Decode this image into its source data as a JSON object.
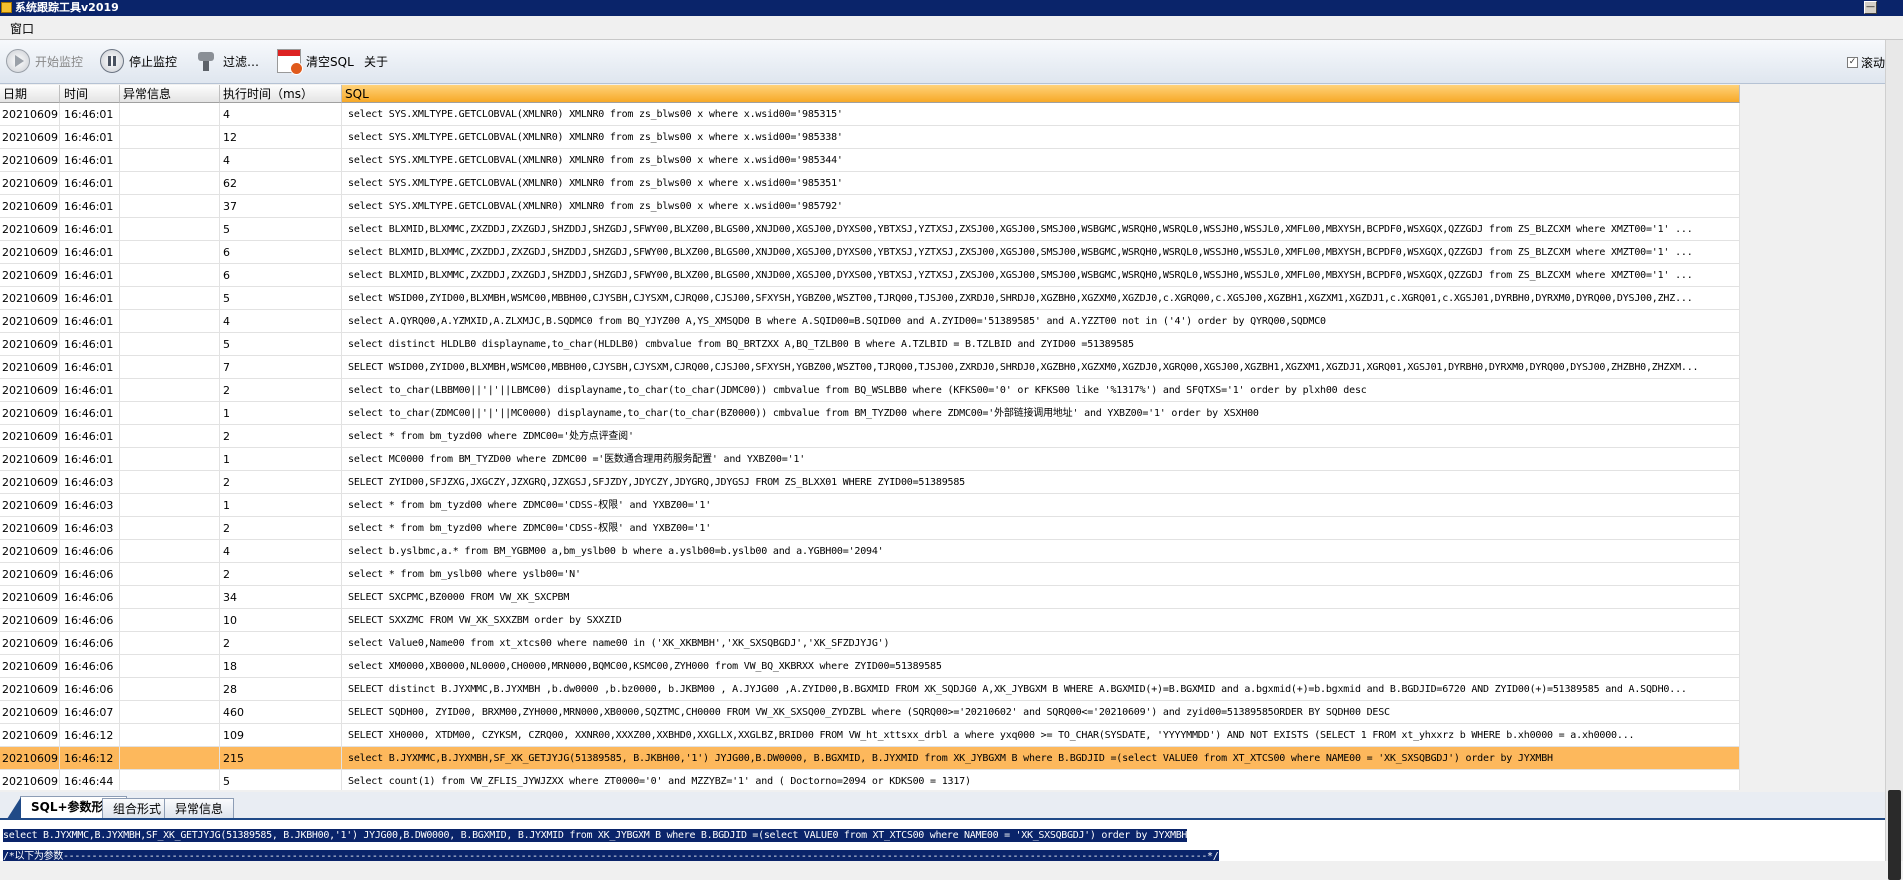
{
  "window": {
    "title": "系统跟踪工具v2019",
    "minimize_glyph": "—"
  },
  "menu": {
    "items": [
      "窗口"
    ]
  },
  "toolbar": {
    "start_label": "开始监控",
    "stop_label": "停止监控",
    "filter_label": "过滤…",
    "clear_label": "清空SQL",
    "about_label": "关于",
    "scroll_label": "滚动",
    "scroll_checked": "✓"
  },
  "grid": {
    "columns": [
      "日期",
      "时间",
      "异常信息",
      "执行时间（ms）",
      "SQL"
    ],
    "rows": [
      {
        "date": "20210609",
        "time": "16:46:01",
        "err": "",
        "ms": "4",
        "sql": "select    SYS.XMLTYPE.GETCLOBVAL(XMLNR0)  XMLNR0 from zs_blws00 x where x.wsid00='985315'"
      },
      {
        "date": "20210609",
        "time": "16:46:01",
        "err": "",
        "ms": "12",
        "sql": "select    SYS.XMLTYPE.GETCLOBVAL(XMLNR0)  XMLNR0 from zs_blws00 x where x.wsid00='985338'"
      },
      {
        "date": "20210609",
        "time": "16:46:01",
        "err": "",
        "ms": "4",
        "sql": "select    SYS.XMLTYPE.GETCLOBVAL(XMLNR0)  XMLNR0 from zs_blws00 x where x.wsid00='985344'"
      },
      {
        "date": "20210609",
        "time": "16:46:01",
        "err": "",
        "ms": "62",
        "sql": "select    SYS.XMLTYPE.GETCLOBVAL(XMLNR0)  XMLNR0 from zs_blws00 x where x.wsid00='985351'"
      },
      {
        "date": "20210609",
        "time": "16:46:01",
        "err": "",
        "ms": "37",
        "sql": "select    SYS.XMLTYPE.GETCLOBVAL(XMLNR0)  XMLNR0 from zs_blws00 x where x.wsid00='985792'"
      },
      {
        "date": "20210609",
        "time": "16:46:01",
        "err": "",
        "ms": "5",
        "sql": "select BLXMID,BLXMMC,ZXZDDJ,ZXZGDJ,SHZDDJ,SHZGDJ,SFWY00,BLXZ00,BLGS00,XNJD00,XGSJ00,DYXS00,YBTXSJ,YZTXSJ,ZXSJ00,XGSJ00,SMSJ00,WSBGMC,WSRQH0,WSRQL0,WSSJH0,WSSJL0,XMFL00,MBXYSH,BCPDF0,WSXGQX,QZZGDJ  from ZS_BLZCXM where XMZT00='1' ..."
      },
      {
        "date": "20210609",
        "time": "16:46:01",
        "err": "",
        "ms": "6",
        "sql": "select BLXMID,BLXMMC,ZXZDDJ,ZXZGDJ,SHZDDJ,SHZGDJ,SFWY00,BLXZ00,BLGS00,XNJD00,XGSJ00,DYXS00,YBTXSJ,YZTXSJ,ZXSJ00,XGSJ00,SMSJ00,WSBGMC,WSRQH0,WSRQL0,WSSJH0,WSSJL0,XMFL00,MBXYSH,BCPDF0,WSXGQX,QZZGDJ  from ZS_BLZCXM where XMZT00='1' ..."
      },
      {
        "date": "20210609",
        "time": "16:46:01",
        "err": "",
        "ms": "6",
        "sql": "select BLXMID,BLXMMC,ZXZDDJ,ZXZGDJ,SHZDDJ,SHZGDJ,SFWY00,BLXZ00,BLGS00,XNJD00,XGSJ00,DYXS00,YBTXSJ,YZTXSJ,ZXSJ00,XGSJ00,SMSJ00,WSBGMC,WSRQH0,WSRQL0,WSSJH0,WSSJL0,XMFL00,MBXYSH,BCPDF0,WSXGQX,QZZGDJ  from ZS_BLZCXM where XMZT00='1' ..."
      },
      {
        "date": "20210609",
        "time": "16:46:01",
        "err": "",
        "ms": "5",
        "sql": "select  WSID00,ZYID00,BLXMBH,WSMC00,MBBH00,CJYSBH,CJYSXM,CJRQ00,CJSJ00,SFXYSH,YGBZ00,WSZT00,TJRQ00,TJSJ00,ZXRDJ0,SHRDJ0,XGZBH0,XGZXM0,XGZDJ0,c.XGRQ00,c.XGSJ00,XGZBH1,XGZXM1,XGZDJ1,c.XGRQ01,c.XGSJ01,DYRBH0,DYRXM0,DYRQ00,DYSJ00,ZHZ..."
      },
      {
        "date": "20210609",
        "time": "16:46:01",
        "err": "",
        "ms": "4",
        "sql": "select A.QYRQ00,A.YZMXID,A.ZLXMJC,B.SQDMC0 from BQ_YJYZ00 A,YS_XMSQD0 B where A.SQID00=B.SQID00 and A.ZYID00='51389585' and A.YZZT00 not in ('4') order by QYRQ00,SQDMC0"
      },
      {
        "date": "20210609",
        "time": "16:46:01",
        "err": "",
        "ms": "5",
        "sql": "select distinct HLDLB0 displayname,to_char(HLDLB0) cmbvalue from BQ_BRTZXX A,BQ_TZLB00 B  where A.TZLBID = B.TZLBID and ZYID00 =51389585"
      },
      {
        "date": "20210609",
        "time": "16:46:01",
        "err": "",
        "ms": "7",
        "sql": "SELECT WSID00,ZYID00,BLXMBH,WSMC00,MBBH00,CJYSBH,CJYSXM,CJRQ00,CJSJ00,SFXYSH,YGBZ00,WSZT00,TJRQ00,TJSJ00,ZXRDJ0,SHRDJ0,XGZBH0,XGZXM0,XGZDJ0,XGRQ00,XGSJ00,XGZBH1,XGZXM1,XGZDJ1,XGRQ01,XGSJ01,DYRBH0,DYRXM0,DYRQ00,DYSJ00,ZHZBH0,ZHZXM..."
      },
      {
        "date": "20210609",
        "time": "16:46:01",
        "err": "",
        "ms": "2",
        "sql": "select to_char(LBBM00||'|'||LBMC00) displayname,to_char(to_char(JDMC00)) cmbvalue from BQ_WSLBB0  where (KFKS00='0' or KFKS00 like '%1317%') and SFQTXS='1' order by plxh00 desc"
      },
      {
        "date": "20210609",
        "time": "16:46:01",
        "err": "",
        "ms": "1",
        "sql": "select to_char(ZDMC00||'|'||MC0000) displayname,to_char(to_char(BZ0000)) cmbvalue from BM_TYZD00  where ZDMC00='外部链接调用地址' and YXBZ00='1' order by XSXH00"
      },
      {
        "date": "20210609",
        "time": "16:46:01",
        "err": "",
        "ms": "2",
        "sql": "select * from bm_tyzd00 where ZDMC00='处方点评查阅'"
      },
      {
        "date": "20210609",
        "time": "16:46:01",
        "err": "",
        "ms": "1",
        "sql": "select MC0000 from BM_TYZD00 where ZDMC00 ='医数通合理用药服务配置' and YXBZ00='1'"
      },
      {
        "date": "20210609",
        "time": "16:46:03",
        "err": "",
        "ms": "2",
        "sql": "SELECT ZYID00,SFJZXG,JXGCZY,JZXGRQ,JZXGSJ,SFJZDY,JDYCZY,JDYGRQ,JDYGSJ FROM ZS_BLXX01 WHERE ZYID00=51389585"
      },
      {
        "date": "20210609",
        "time": "16:46:03",
        "err": "",
        "ms": "1",
        "sql": "select * from bm_tyzd00 where ZDMC00='CDSS-权限' and YXBZ00='1'"
      },
      {
        "date": "20210609",
        "time": "16:46:03",
        "err": "",
        "ms": "2",
        "sql": "select * from bm_tyzd00 where ZDMC00='CDSS-权限' and YXBZ00='1'"
      },
      {
        "date": "20210609",
        "time": "16:46:06",
        "err": "",
        "ms": "4",
        "sql": "select b.yslbmc,a.* from BM_YGBM00 a,bm_yslb00 b  where a.yslb00=b.yslb00 and  a.YGBH00='2094'"
      },
      {
        "date": "20210609",
        "time": "16:46:06",
        "err": "",
        "ms": "2",
        "sql": "select * from bm_yslb00 where yslb00='N'"
      },
      {
        "date": "20210609",
        "time": "16:46:06",
        "err": "",
        "ms": "34",
        "sql": "SELECT SXCPMC,BZ0000 FROM VW_XK_SXCPBM"
      },
      {
        "date": "20210609",
        "time": "16:46:06",
        "err": "",
        "ms": "10",
        "sql": "SELECT SXXZMC FROM VW_XK_SXXZBM order by SXXZID"
      },
      {
        "date": "20210609",
        "time": "16:46:06",
        "err": "",
        "ms": "2",
        "sql": "select Value0,Name00 from xt_xtcs00 where name00 in ('XK_XKBMBH','XK_SXSQBGDJ','XK_SFZDJYJG')"
      },
      {
        "date": "20210609",
        "time": "16:46:06",
        "err": "",
        "ms": "18",
        "sql": " select XM0000,XB0000,NL0000,CH0000,MRN000,BQMC00,KSMC00,ZYH000 from VW_BQ_XKBRXX where ZYID00=51389585"
      },
      {
        "date": "20210609",
        "time": "16:46:06",
        "err": "",
        "ms": "28",
        "sql": "SELECT distinct B.JYXMMC,B.JYXMBH ,b.dw0000 ,b.bz0000, b.JKBM00 ,  A.JYJG00 ,A.ZYID00,B.BGXMID FROM XK_SQDJG0 A,XK_JYBGXM B WHERE A.BGXMID(+)=B.BGXMID and  a.bgxmid(+)=b.bgxmid and B.BGDJID=6720 AND ZYID00(+)=51389585 and A.SQDH0..."
      },
      {
        "date": "20210609",
        "time": "16:46:07",
        "err": "",
        "ms": "460",
        "sql": " SELECT SQDH00, ZYID00,  BRXM00,ZYH000,MRN000,XB0000,SQZTMC,CH0000 FROM VW_XK_SXSQ00_ZYDZBL  where  (SQRQ00>='20210602'  and SQRQ00<='20210609')  and zyid00=51389585ORDER BY SQDH00 DESC"
      },
      {
        "date": "20210609",
        "time": "16:46:12",
        "err": "",
        "ms": "109",
        "sql": " SELECT XH0000,  XTDM00,  CZYKSM,  CZRQ00,  XXNR00,XXXZ00,XXBHD0,XXGLLX,XXGLBZ,BRID00    FROM VW_ht_xttsxx_drbl a  where yxq000 >= TO_CHAR(SYSDATE, 'YYYYMMDD')       AND NOT EXISTS  (SELECT 1 FROM xt_yhxxrz b WHERE b.xh0000 = a.xh0000..."
      },
      {
        "date": "20210609",
        "time": "16:46:12",
        "err": "",
        "ms": "215",
        "sql": " select B.JYXMMC,B.JYXMBH,SF_XK_GETJYJG(51389585, B.JKBH00,'1') JYJG00,B.DW0000, B.BGXMID, B.JYXMID from XK_JYBGXM B where B.BGDJID =(select VALUE0 from XT_XTCS00 where NAME00 = 'XK_SXSQBGDJ') order by JYXMBH"
      },
      {
        "date": "20210609",
        "time": "16:46:44",
        "err": "",
        "ms": "5",
        "sql": " Select count(1)  from VW_ZFLIS_JYWJZXX  where ZT0000='0' and MZZYBZ='1' and ( Doctorno=2094 or KDKS00 = 1317)"
      }
    ],
    "selected_index": 28
  },
  "tabs": [
    "SQL+参数形式",
    "组合形式",
    "异常信息"
  ],
  "bottom": {
    "line1": "select B.JYXMMC,B.JYXMBH,SF_XK_GETJYJG(51389585, B.JKBH00,'1') JYJG00,B.DW0000, B.BGXMID, B.JYXMID from XK_JYBGXM B where B.BGDJID =(select VALUE0 from XT_XTCS00 where NAME00 = 'XK_SXSQBGDJ') order by JYXMBH",
    "line2": "/*以下为参数--------------------------------------------------------------------------------------------------------------------------------------------------------------------------------------------------------*/"
  },
  "colors": {
    "title_bar": "#0a246a",
    "selected_row": "#fdb85c",
    "sql_header": "#f7a928"
  }
}
